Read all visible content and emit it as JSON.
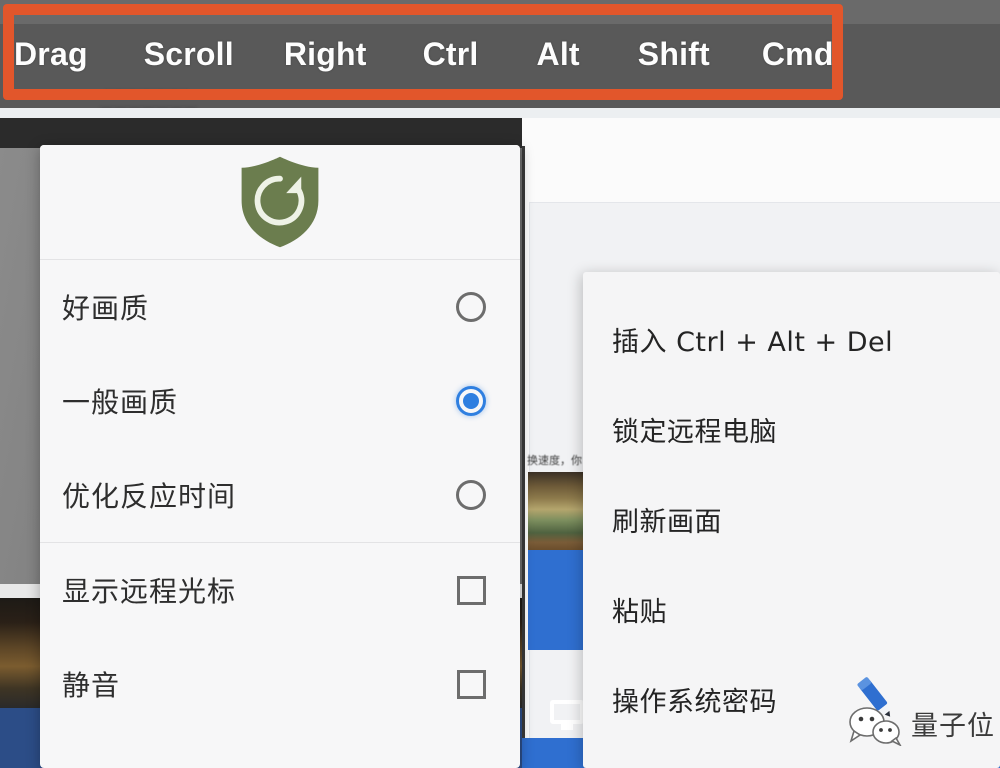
{
  "toolbar": {
    "keys": [
      {
        "label": "Drag",
        "name": "drag"
      },
      {
        "label": "Scroll",
        "name": "scroll"
      },
      {
        "label": "Right",
        "name": "right"
      },
      {
        "label": "Ctrl",
        "name": "ctrl"
      },
      {
        "label": "Alt",
        "name": "alt"
      },
      {
        "label": "Shift",
        "name": "shift"
      },
      {
        "label": "Cmd",
        "name": "cmd"
      }
    ],
    "ghost_text_top": "————",
    "ghost_text_mid": "——————",
    "ghost_text_low": "———————",
    "highlight_color": "#e2562b"
  },
  "quality_dialog": {
    "icon_name": "shield-refresh-icon",
    "icon_color": "#6b7d4e",
    "accent_color": "#2f7fe0",
    "quality_options": [
      {
        "label": "好画质",
        "selected": false
      },
      {
        "label": "一般画质",
        "selected": true
      },
      {
        "label": "优化反应时间",
        "selected": false
      }
    ],
    "toggles": [
      {
        "label": "显示远程光标",
        "checked": false
      },
      {
        "label": "静音",
        "checked": false
      }
    ]
  },
  "context_menu": {
    "items": [
      {
        "label": "插入 Ctrl + Alt + Del",
        "name": "insert-ctrl-alt-del"
      },
      {
        "label": "锁定远程电脑",
        "name": "lock-remote-pc"
      },
      {
        "label": "刷新画面",
        "name": "refresh-screen"
      },
      {
        "label": "粘贴",
        "name": "paste"
      },
      {
        "label": "操作系统密码",
        "name": "os-password"
      }
    ]
  },
  "background": {
    "thumb_label": "换速度，你",
    "blue_color": "#2f6fd0"
  },
  "watermark": {
    "text": "量子位",
    "logo_name": "wechat-pencil-logo"
  }
}
